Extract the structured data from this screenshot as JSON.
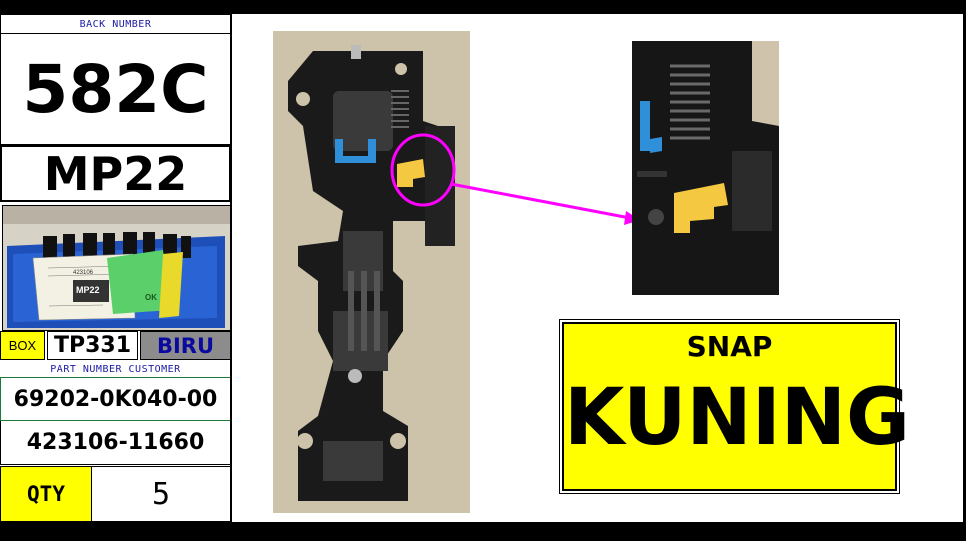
{
  "left_panel": {
    "back_number_label": "BACK NUMBER",
    "back_number": "582C",
    "model_code": "MP22",
    "box_label": "BOX",
    "box_code": "TP331",
    "box_color": "BIRU",
    "part_number_label": "PART NUMBER CUSTOMER",
    "part_number_1": "69202-0K040-00",
    "part_number_2": "423106-11660",
    "qty_label": "QTY",
    "qty_value": "5"
  },
  "box_photo": {
    "tag_text": "MP22",
    "ok_text": "OK",
    "label_number": "423106"
  },
  "callout": {
    "title": "SNAP",
    "value": "KUNING"
  },
  "colors": {
    "yellow": "#ffff00",
    "biru_bg": "#8c8c8c",
    "biru_text": "#0a0aa0",
    "callout_magenta": "#ff00ff",
    "part_yellow": "#f5c842",
    "clip_blue": "#2f8fd8"
  }
}
